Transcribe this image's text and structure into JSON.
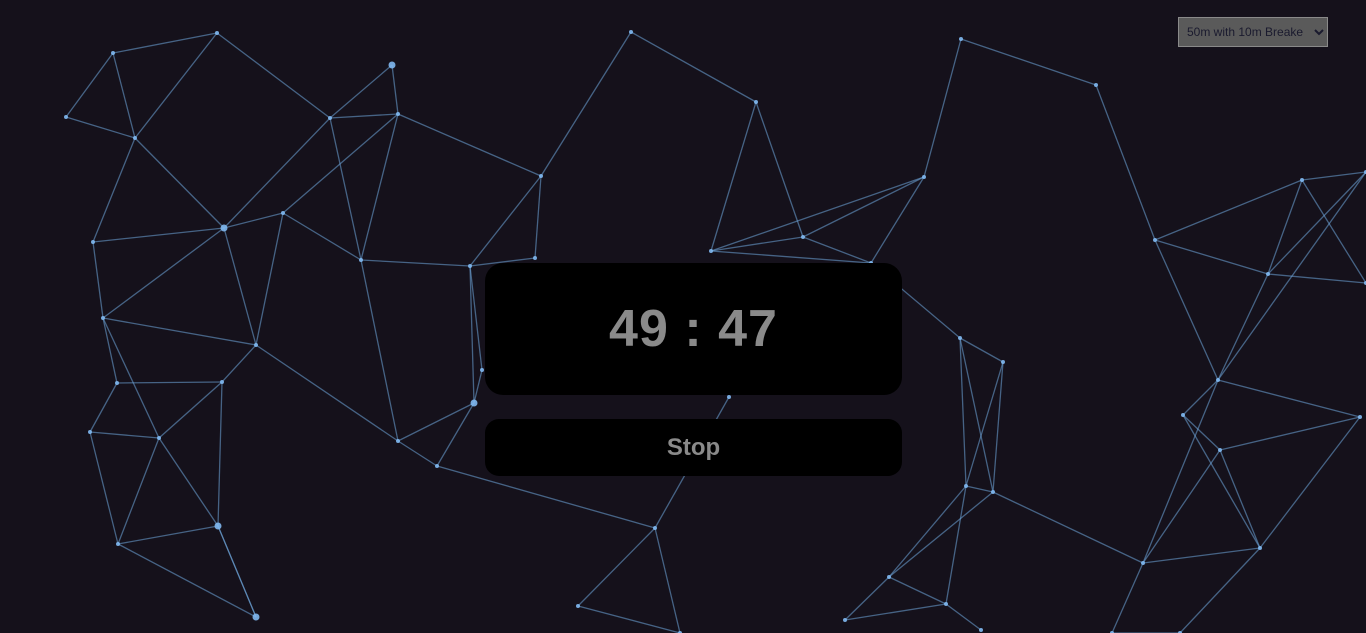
{
  "mode_select": {
    "selected": "50m with 10m Breake",
    "options": [
      "50m with 10m Breake"
    ]
  },
  "timer": {
    "minutes": "49",
    "separator": ":",
    "seconds": "47"
  },
  "stop_button": {
    "label": "Stop"
  },
  "colors": {
    "background": "#15111b",
    "network_line": "#6fa8dc",
    "network_node": "#7fb8f0",
    "panel": "#000000",
    "text": "#8a8a8a"
  }
}
